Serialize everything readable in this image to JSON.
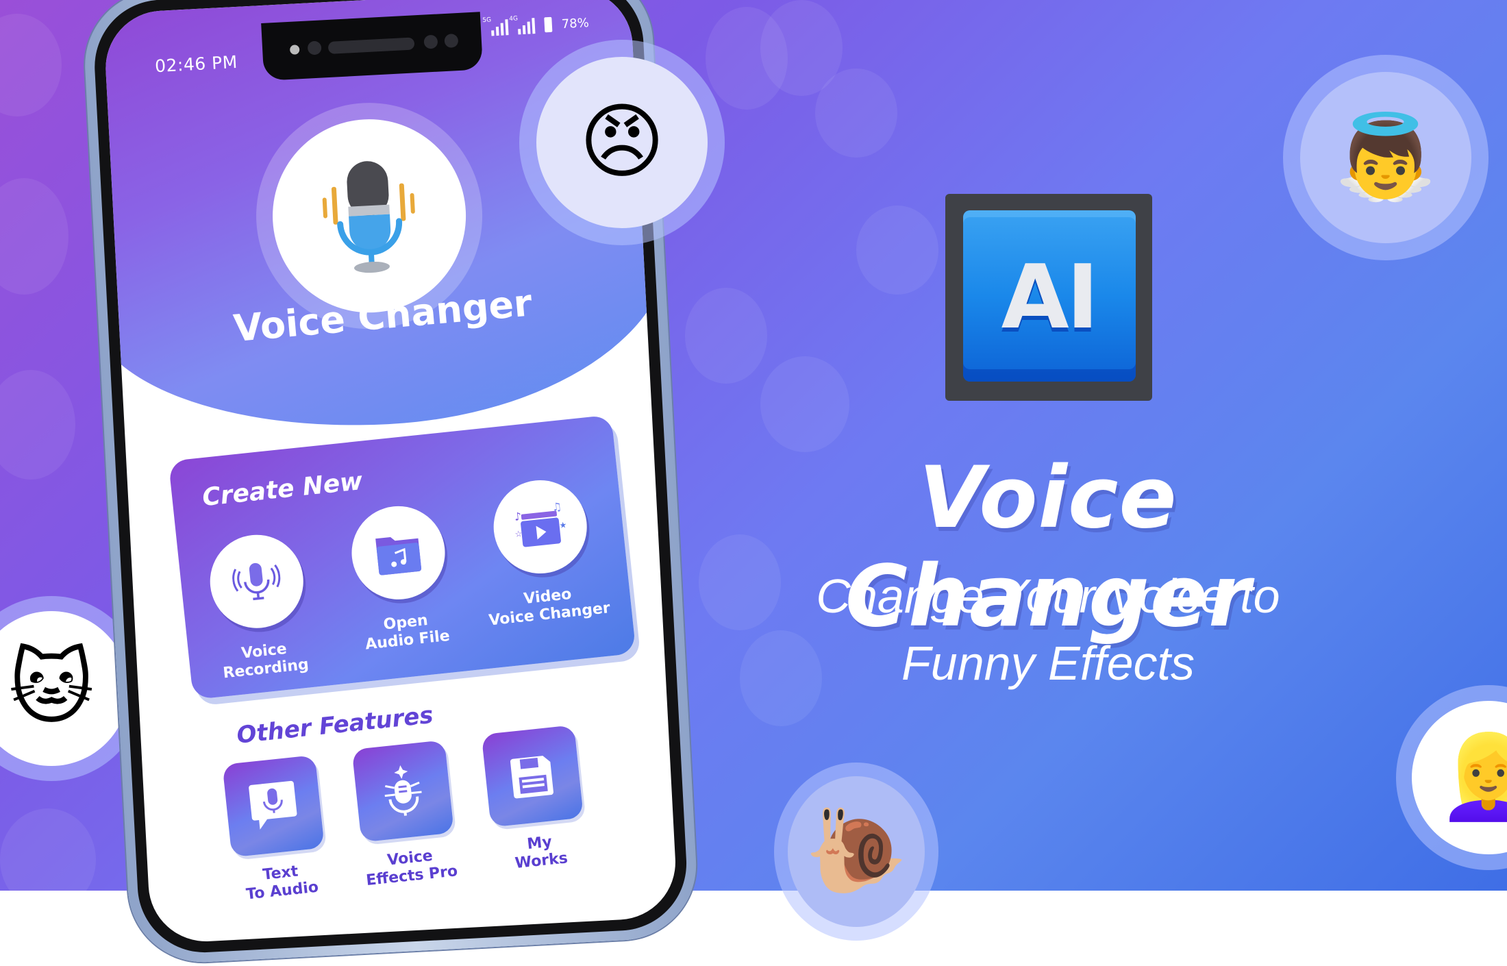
{
  "colors": {
    "bg_purple": "#9a4fd8",
    "bg_blue": "#3f6ee6",
    "accent_text": "#6244d6",
    "ai_key_blue": "#1a88ea",
    "white": "#ffffff"
  },
  "phone": {
    "status_bar": {
      "time": "02:46 PM",
      "signal_1_label": "5G",
      "signal_2_label": "4G",
      "battery": "78%"
    },
    "header": {
      "icon": "microphone-icon",
      "title": "Voice Changer"
    },
    "create_new": {
      "title": "Create New",
      "actions": [
        {
          "icon": "voice-recording-icon",
          "line1": "Voice",
          "line2": "Recording"
        },
        {
          "icon": "audio-folder-icon",
          "line1": "Open",
          "line2": "Audio File"
        },
        {
          "icon": "video-play-icon",
          "line1": "Video",
          "line2": "Voice Changer"
        }
      ]
    },
    "other_features": {
      "title": "Other Features",
      "items": [
        {
          "icon": "text-to-audio-icon",
          "line1": "Text",
          "line2": "To Audio"
        },
        {
          "icon": "voice-effects-icon",
          "line1": "Voice",
          "line2": "Effects Pro"
        },
        {
          "icon": "floppy-disk-icon",
          "line1": "My",
          "line2": "Works"
        }
      ]
    }
  },
  "promo": {
    "badge": "AI",
    "title": "Voice Changer",
    "subtitle_line1": "Change Your Voice to",
    "subtitle_line2": "Funny Effects"
  },
  "avatars": [
    {
      "name": "angry-man-avatar",
      "glyph": "😠"
    },
    {
      "name": "angel-baby-avatar",
      "glyph": "👼"
    },
    {
      "name": "cat-avatar",
      "glyph": "🐱"
    },
    {
      "name": "snail-avatar",
      "glyph": "🐌"
    },
    {
      "name": "girl-avatar",
      "glyph": "👱‍♀️"
    }
  ]
}
